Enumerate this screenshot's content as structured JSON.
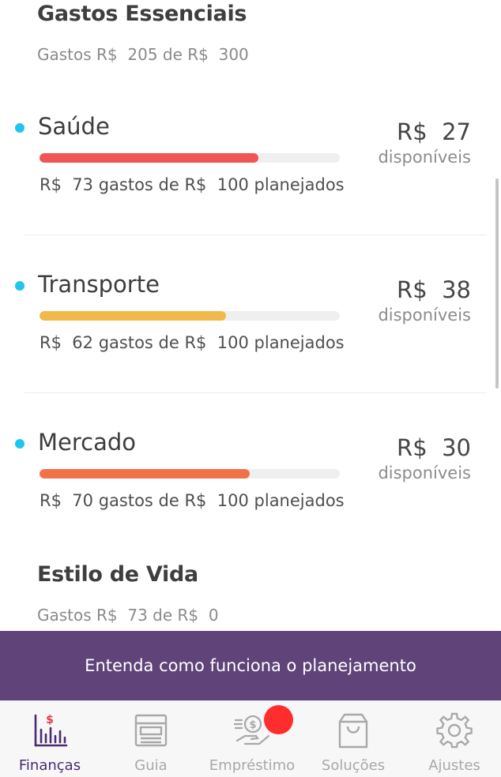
{
  "colors": {
    "dot": "#1ec6ec",
    "banner": "#5f4379",
    "active_tab": "#4b2b6f",
    "badge": "#ff2d2d"
  },
  "sections": [
    {
      "title": "Gastos Essenciais",
      "subtitle": "Gastos R$  205 de R$  300"
    },
    {
      "title": "Estilo de Vida",
      "subtitle": "Gastos R$  73 de R$  0"
    }
  ],
  "categories": [
    {
      "name": "Saúde",
      "amount": "R$  27",
      "available": "disponíveis",
      "detail": "R$  73 gastos de R$  100 planejados",
      "progress": 0.73,
      "color": "#f05454"
    },
    {
      "name": "Transporte",
      "amount": "R$  38",
      "available": "disponíveis",
      "detail": "R$  62 gastos de R$  100 planejados",
      "progress": 0.62,
      "color": "#f0b94a"
    },
    {
      "name": "Mercado",
      "amount": "R$  30",
      "available": "disponíveis",
      "detail": "R$  70 gastos de R$  100 planejados",
      "progress": 0.7,
      "color": "#ef7347"
    }
  ],
  "banner": {
    "text": "Entenda como funciona o planejamento"
  },
  "tabs": [
    {
      "label": "Finanças",
      "icon": "finance-chart-icon",
      "active": true
    },
    {
      "label": "Guia",
      "icon": "guide-document-icon",
      "active": false
    },
    {
      "label": "Empréstimo",
      "icon": "loan-money-hand-icon",
      "active": false
    },
    {
      "label": "Soluções",
      "icon": "shopping-bag-icon",
      "active": false
    },
    {
      "label": "Ajustes",
      "icon": "gear-icon",
      "active": false
    }
  ]
}
